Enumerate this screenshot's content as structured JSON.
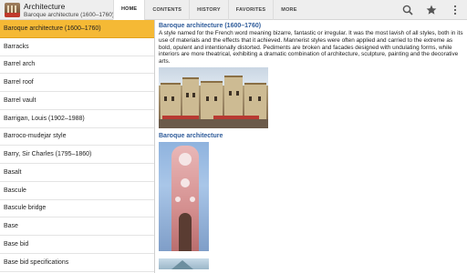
{
  "app": {
    "title": "Architecture",
    "subtitle": "Baroque architecture (1600–1760)"
  },
  "tabs": [
    {
      "label": "HOME",
      "active": true
    },
    {
      "label": "CONTENTS",
      "active": false
    },
    {
      "label": "HISTORY",
      "active": false
    },
    {
      "label": "FAVORITES",
      "active": false
    },
    {
      "label": "MORE",
      "active": false
    }
  ],
  "actions": [
    {
      "icon": "search-icon"
    },
    {
      "icon": "star-icon"
    },
    {
      "icon": "overflow-menu-icon"
    }
  ],
  "list": {
    "selected_index": 0,
    "items": [
      "Baroque architecture (1600–1760)",
      "Barracks",
      "Barrel arch",
      "Barrel roof",
      "Barrel vault",
      "Barrigan, Louis (1902–1988)",
      "Barroco-mudejar style",
      "Barry, Sir Charles (1795–1860)",
      "Basalt",
      "Bascule",
      "Bascule bridge",
      "Base",
      "Base bid",
      "Base bid specifications"
    ]
  },
  "article": {
    "title": "Baroque architecture (1600–1760)",
    "body": "A style named for the French word meaning bizarre, fantastic or irregular. It was the most lavish of all styles, both in its use of materials and the effects that it achieved. Mannerist styles were often applied and carried to the extreme as bold, opulent and intentionally distorted. Pediments are broken and facades designed with undulating forms, while interiors are more theatrical, exhibiting a dramatic combination of architecture, sculpture, painting and the decorative arts.",
    "section_title": "Baroque architecture"
  },
  "colors": {
    "accent": "#f5b935",
    "link_title": "#2e5b9a",
    "toolbar_bg": "#eeeeee"
  }
}
